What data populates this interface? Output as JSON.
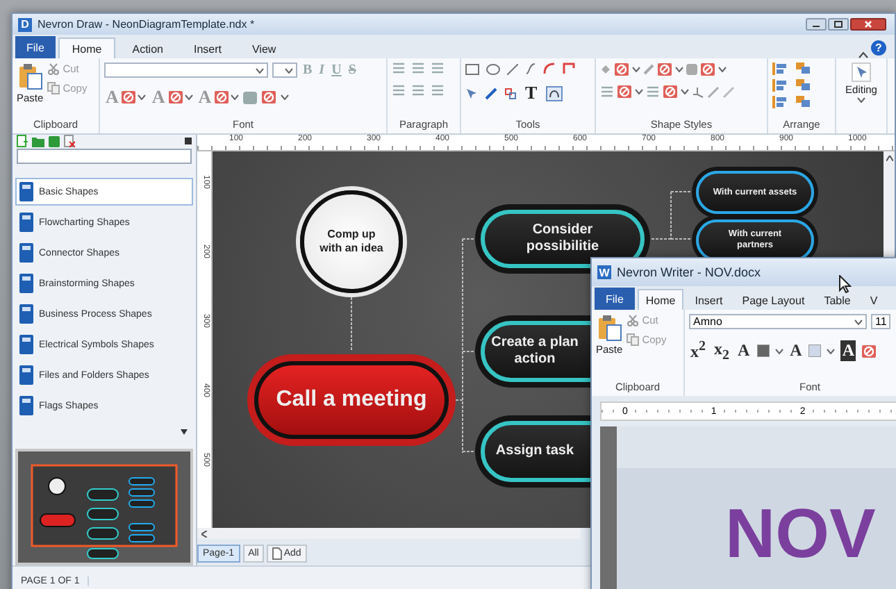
{
  "draw_window": {
    "app_icon": "D",
    "title": "Nevron Draw - NeonDiagramTemplate.ndx *",
    "tabs": [
      {
        "label": "File",
        "kind": "file",
        "selected": false
      },
      {
        "label": "Home",
        "kind": "tab",
        "selected": true
      },
      {
        "label": "Action",
        "kind": "tab",
        "selected": false
      },
      {
        "label": "Insert",
        "kind": "tab",
        "selected": false
      },
      {
        "label": "View",
        "kind": "tab",
        "selected": false
      }
    ],
    "help": "?",
    "ribbon": {
      "clipboard": {
        "paste": "Paste",
        "cut": "Cut",
        "copy": "Copy",
        "label": "Clipboard"
      },
      "font": {
        "style_buttons": [
          "B",
          "I",
          "U",
          "S"
        ],
        "color_buttons": [
          "A",
          "A",
          "A"
        ],
        "label": "Font"
      },
      "paragraph": {
        "label": "Paragraph"
      },
      "tools": {
        "text_tool": "T",
        "label": "Tools"
      },
      "shape_styles": {
        "label": "Shape Styles"
      },
      "arrange": {
        "label": "Arrange"
      },
      "editing": {
        "label": "Editing"
      }
    },
    "ruler": {
      "horizontal": [
        "100",
        "200",
        "300",
        "400",
        "500",
        "600",
        "700",
        "800",
        "900",
        "1000"
      ],
      "vertical": [
        "100",
        "200",
        "300",
        "400",
        "500"
      ]
    },
    "library": {
      "items": [
        {
          "label": "Basic Shapes",
          "selected": true
        },
        {
          "label": "Flowcharting Shapes",
          "selected": false
        },
        {
          "label": "Connector Shapes",
          "selected": false
        },
        {
          "label": "Brainstorming Shapes",
          "selected": false
        },
        {
          "label": "Business Process Shapes",
          "selected": false
        },
        {
          "label": "Electrical Symbols Shapes",
          "selected": false
        },
        {
          "label": "Files and Folders Shapes",
          "selected": false
        },
        {
          "label": "Flags Shapes",
          "selected": false
        }
      ]
    },
    "diagram": {
      "nodes": [
        {
          "kind": "idea",
          "lines": [
            "Comp up",
            "with an idea"
          ]
        },
        {
          "kind": "main",
          "lines": [
            "Call a meeting"
          ]
        },
        {
          "kind": "option",
          "lines": [
            "Consider",
            "possibilitie"
          ]
        },
        {
          "kind": "option",
          "lines": [
            "Create a plan",
            "action"
          ]
        },
        {
          "kind": "option",
          "lines": [
            "Assign task"
          ]
        },
        {
          "kind": "sub",
          "lines": [
            "With current assets"
          ]
        },
        {
          "kind": "sub",
          "lines": [
            "With current",
            "partners"
          ]
        }
      ]
    },
    "page_tabs": [
      {
        "label": "Page-1",
        "kind": "page",
        "selected": true
      },
      {
        "label": "All",
        "kind": "page",
        "selected": false
      },
      {
        "label": "Add",
        "kind": "add",
        "selected": false
      }
    ],
    "status": "PAGE 1 OF 1"
  },
  "writer_window": {
    "app_icon": "W",
    "title": "Nevron Writer - NOV.docx",
    "tabs": [
      {
        "label": "File",
        "kind": "file",
        "selected": false
      },
      {
        "label": "Home",
        "kind": "tab",
        "selected": true
      },
      {
        "label": "Insert",
        "kind": "tab",
        "selected": false
      },
      {
        "label": "Page Layout",
        "kind": "tab",
        "selected": false
      },
      {
        "label": "Table",
        "kind": "tab",
        "selected": false
      },
      {
        "label": "V",
        "kind": "tab",
        "selected": false
      }
    ],
    "clipboard": {
      "paste": "Paste",
      "cut": "Cut",
      "copy": "Copy",
      "label": "Clipboard"
    },
    "font": {
      "name": "Amno",
      "size": "11",
      "buttons": [
        "x$^{2}$",
        "x$_{2}$",
        "A",
        "A",
        "A"
      ],
      "label": "Font"
    },
    "ruler": [
      "0",
      "1",
      "2"
    ],
    "document_text": "NOV"
  }
}
